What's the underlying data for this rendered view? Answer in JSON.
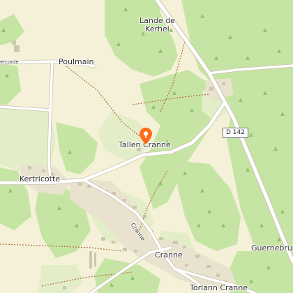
{
  "map": {
    "labels": {
      "lande_de_kerhel": "Lande de\nKerhel",
      "lande_line1": "Lande de",
      "lande_line2": "Kerhel",
      "poulmain": "Poulmain",
      "kercorde": "ercorde",
      "tallen_cranne": "Tallen Cranne",
      "kertricotte": "Kertricotte",
      "cranne_road": "Cranne",
      "cranne": "Cranne",
      "torlann_cranne": "Torlann Cranne",
      "guernebrun": "Guernebrun"
    },
    "road_shield": "D 142",
    "marker": {
      "icon": "location-pin-icon",
      "color": "#ff6b1a"
    },
    "colors": {
      "forest": "#c6e5a4",
      "forest_dark": "#a9d88a",
      "meadow": "#e5eecd",
      "land": "#f4f1d8",
      "road": "#ffffff",
      "road_casing": "#c9c3ae",
      "path": "#b36a3a"
    }
  }
}
